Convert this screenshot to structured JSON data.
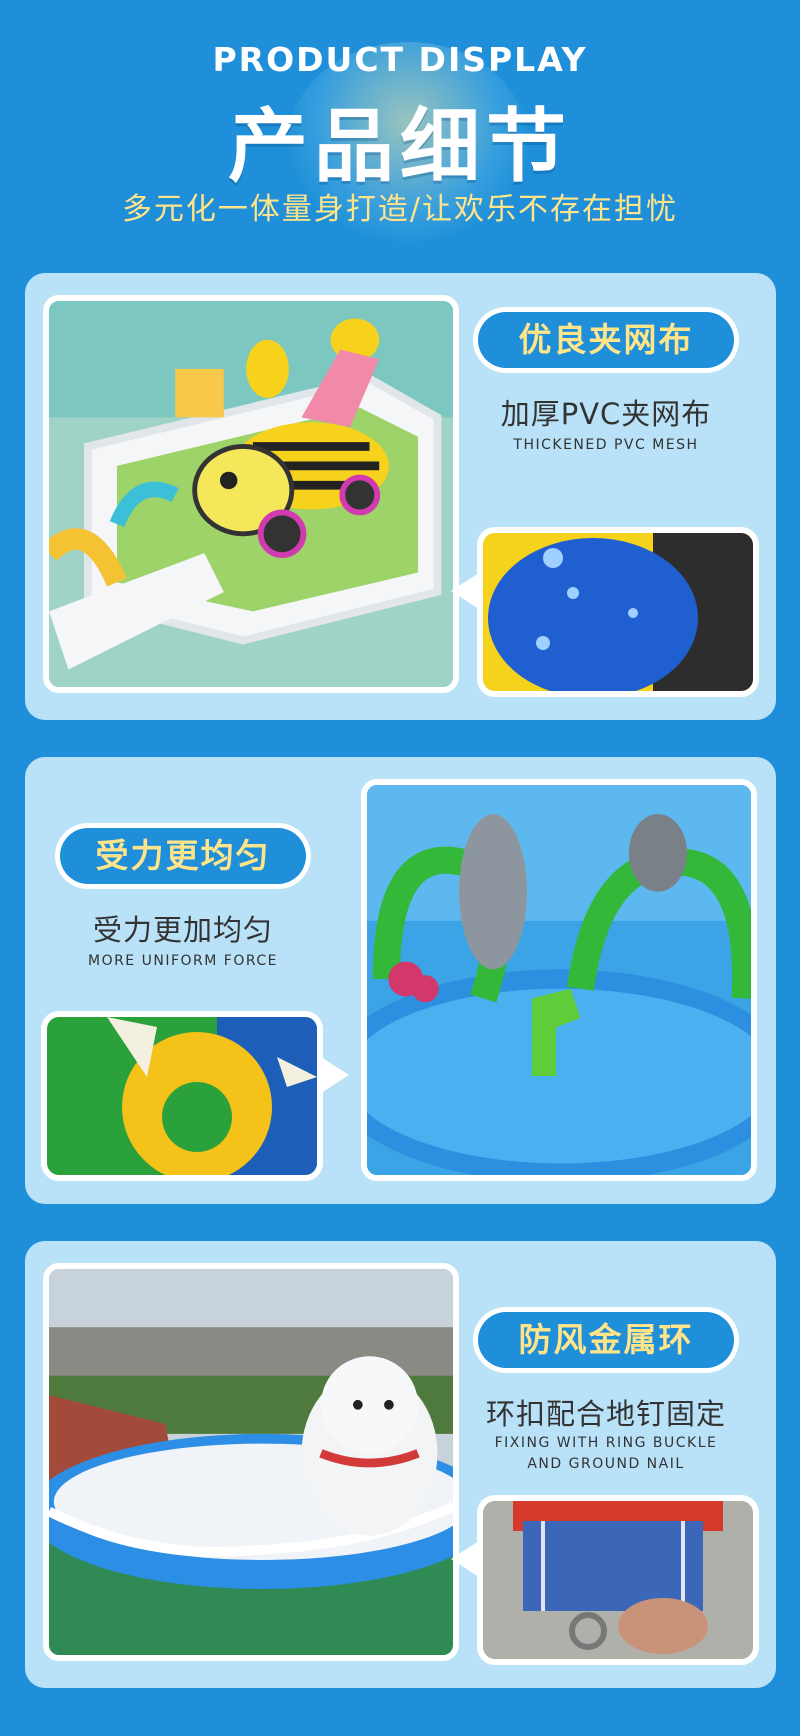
{
  "header": {
    "en_title": "PRODUCT DISPLAY",
    "cn_title": "产品细节",
    "subtitle": "多元化一体量身打造/让欢乐不存在担忧"
  },
  "sections": [
    {
      "badge": "优良夹网布",
      "caption_cn": "加厚PVC夹网布",
      "caption_en": "THICKENED PVC MESH"
    },
    {
      "badge": "受力更均匀",
      "caption_cn": "受力更加均匀",
      "caption_en": "MORE UNIFORM FORCE"
    },
    {
      "badge": "防风金属环",
      "caption_cn": "环扣配合地钉固定",
      "caption_en_line1": "FIXING WITH RING BUCKLE",
      "caption_en_line2": "AND GROUND NAIL"
    }
  ],
  "colors": {
    "background": "#1e8fd8",
    "card": "#b9e2f8",
    "badge_fill": "#1e8fd8",
    "badge_text": "#ffe48a",
    "subtitle": "#ffe48a"
  }
}
